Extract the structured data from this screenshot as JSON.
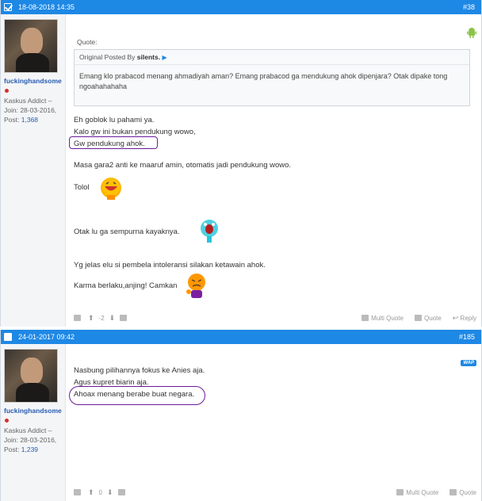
{
  "post1": {
    "date": "18-08-2018 14:35",
    "number": "#38",
    "user": {
      "name": "fuckinghandsome",
      "rank": "Kaskus Addict –",
      "join": "Join: 28-03-2016,",
      "posts_label": "Post:",
      "posts": "1,368"
    },
    "quote_label": "Quote:",
    "quote_by_prefix": "Original Posted By",
    "quote_author": "silents.",
    "quote_text": "Emang klo prabacod menang ahmadiyah aman? Emang prabacod ga mendukung ahok dipenjara? Otak dipake tong ngoahahahaha",
    "lines": [
      "Eh goblok lu pahami ya.",
      "Kalo gw ini bukan pendukung wowo,",
      "Gw pendukung ahok.",
      "Masa gara2 anti ke maaruf amin, otomatis jadi pendukung wowo.",
      "Tolol",
      "Otak lu ga sempurna kayaknya.",
      "Yg jelas elu si pembela intoleransi silakan ketawain ahok.",
      "Karma berlaku,anjing! Camkan"
    ],
    "footer": {
      "vote_count": "-2",
      "multi_quote": "Multi Quote",
      "quote": "Quote",
      "reply": "Reply"
    }
  },
  "post2": {
    "date": "24-01-2017 09:42",
    "number": "#185",
    "wap": "WAP",
    "user": {
      "name": "fuckinghandsome",
      "rank": "Kaskus Addict –",
      "join": "Join: 28-03-2016,",
      "posts_label": "Post:",
      "posts": "1,239"
    },
    "lines": [
      "Nasbung pilihannya fokus ke Anies aja.",
      "Agus kupret biarin aja.",
      "Ahoax menang berabe buat negara."
    ],
    "footer": {
      "vote_count": "0",
      "multi_quote": "Multi Quote",
      "quote": "Quote"
    }
  },
  "colors": {
    "header_blue": "#1e88e5",
    "username_blue": "#2a5db0",
    "annotation_purple": "#6a1b9a"
  },
  "icons": [
    "checkbox-icon",
    "android-icon",
    "wap-icon",
    "laughing-emoji",
    "screaming-emoji",
    "angry-emoji",
    "thumbs-up-icon",
    "thumbs-down-icon",
    "multi-quote-icon",
    "quote-icon",
    "reply-icon"
  ]
}
